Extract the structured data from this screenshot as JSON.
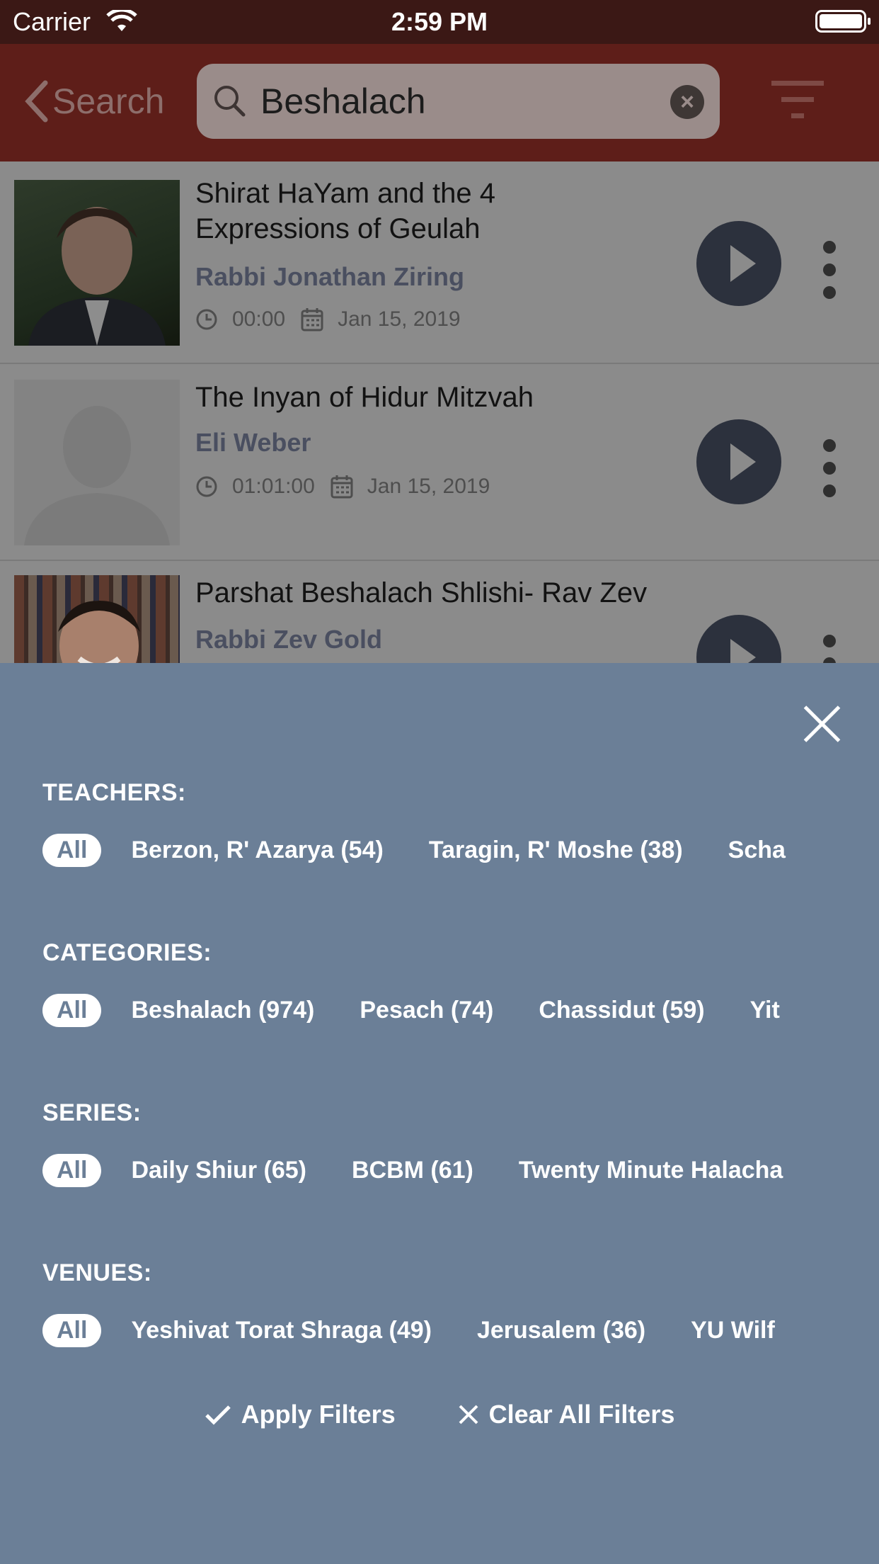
{
  "status_bar": {
    "carrier": "Carrier",
    "time": "2:59 PM"
  },
  "nav": {
    "back_label": "Search",
    "search_query": "Beshalach"
  },
  "results": [
    {
      "title": "Shirat HaYam and the 4 Expressions of Geulah",
      "author": "Rabbi Jonathan Ziring",
      "duration": "00:00",
      "date": "Jan 15, 2019"
    },
    {
      "title": "The Inyan of Hidur Mitzvah",
      "author": "Eli Weber",
      "duration": "01:01:00",
      "date": "Jan 15, 2019"
    },
    {
      "title": "Parshat Beshalach Shlishi- Rav Zev",
      "author": "Rabbi Zev Gold"
    }
  ],
  "filters": {
    "teachers": {
      "label": "TEACHERS:",
      "chips": [
        "All",
        "Berzon, R' Azarya (54)",
        "Taragin, R' Moshe (38)",
        "Scha"
      ]
    },
    "categories": {
      "label": "CATEGORIES:",
      "chips": [
        "All",
        "Beshalach (974)",
        "Pesach (74)",
        "Chassidut (59)",
        "Yit"
      ]
    },
    "series": {
      "label": "SERIES:",
      "chips": [
        "All",
        "Daily Shiur (65)",
        "BCBM (61)",
        "Twenty Minute Halacha"
      ]
    },
    "venues": {
      "label": "VENUES:",
      "chips": [
        "All",
        "Yeshivat Torat Shraga (49)",
        "Jerusalem (36)",
        "YU Wilf"
      ]
    }
  },
  "actions": {
    "apply": "Apply Filters",
    "clear": "Clear All Filters"
  },
  "colors": {
    "nav_bar": "#5e1e19",
    "panel": "#6b7f97",
    "play_button": "#2c313d"
  }
}
